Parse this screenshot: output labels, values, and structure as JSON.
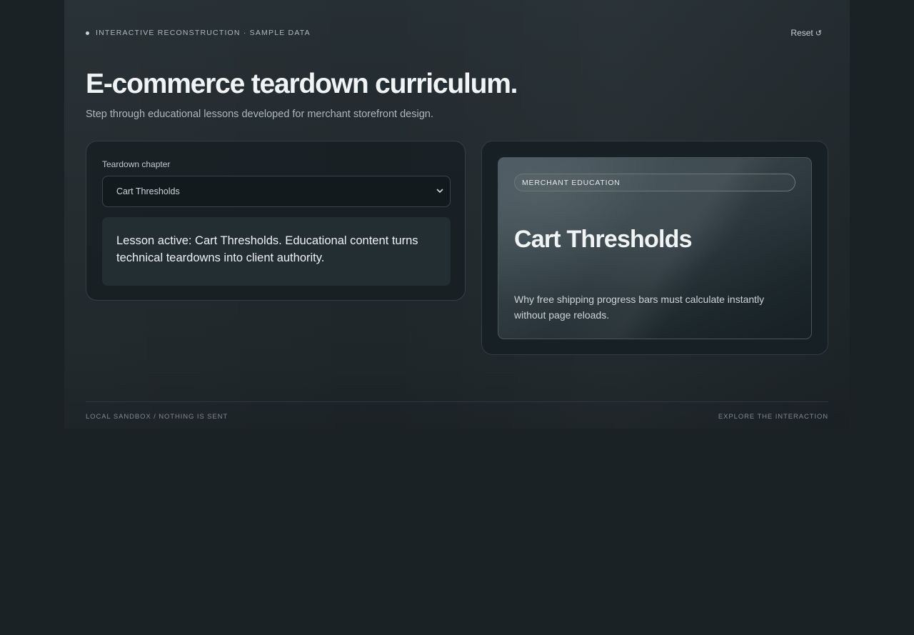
{
  "header": {
    "kicker": "INTERACTIVE RECONSTRUCTION · SAMPLE DATA",
    "reset_label": "Reset",
    "reset_icon": "↺"
  },
  "hero_section": {
    "title": "E-commerce teardown curriculum.",
    "subtitle": "Step through educational lessons developed for merchant storefront design."
  },
  "chapter_panel": {
    "label": "Teardown chapter",
    "selected_value": "Cart Thresholds",
    "status_text": "Lesson active: Cart Thresholds. Educational content turns technical teardowns into client authority."
  },
  "lesson_card": {
    "badge": "MERCHANT EDUCATION",
    "title": "Cart Thresholds",
    "description": "Why free shipping progress bars must calculate instantly without page reloads."
  },
  "footer": {
    "left": "LOCAL SANDBOX / NOTHING IS SENT",
    "right": "EXPLORE THE INTERACTION"
  }
}
